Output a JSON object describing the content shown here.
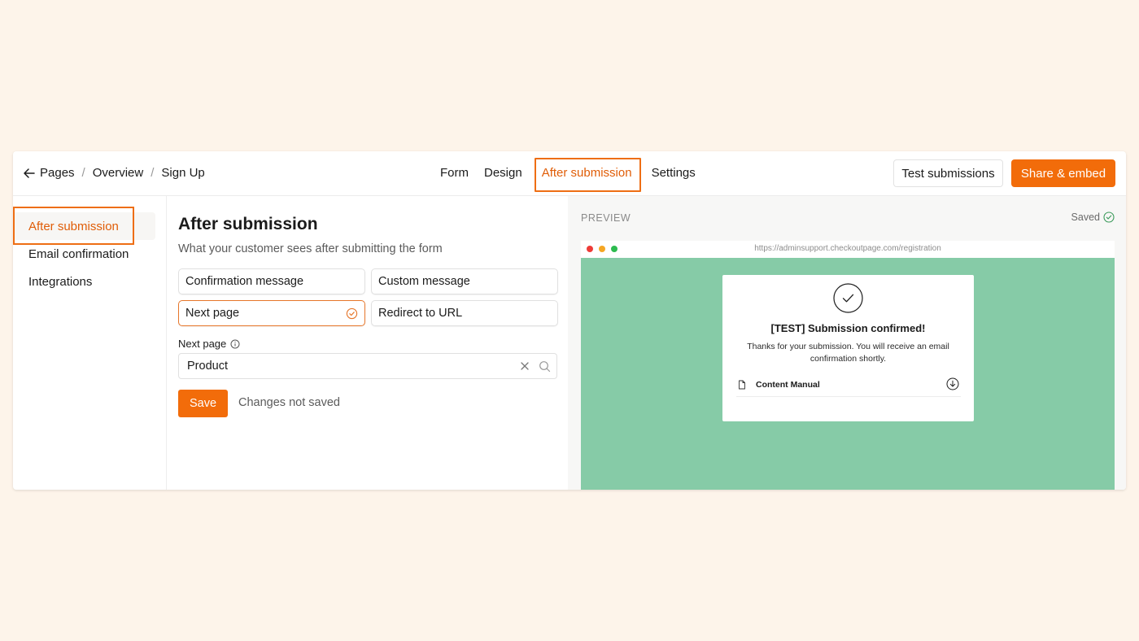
{
  "breadcrumb": [
    "Pages",
    "Overview",
    "Sign Up"
  ],
  "breadcrumb_sep": "/",
  "tabs": {
    "form": "Form",
    "design": "Design",
    "after_submission": "After submission",
    "settings": "Settings",
    "active": "After submission"
  },
  "header_buttons": {
    "test": "Test submissions",
    "share": "Share & embed"
  },
  "sidebar": {
    "items": [
      "After submission",
      "Email confirmation",
      "Integrations"
    ],
    "active": "After submission"
  },
  "main": {
    "title": "After submission",
    "subtitle": "What your customer sees after submitting the form",
    "options": [
      "Confirmation message",
      "Custom message",
      "Next page",
      "Redirect to URL"
    ],
    "selected_option": "Next page",
    "next_page_label": "Next page",
    "next_page_value": "Product",
    "save_label": "Save",
    "status": "Changes not saved"
  },
  "preview": {
    "label": "PREVIEW",
    "saved": "Saved",
    "url": "https://adminsupport.checkoutpage.com/registration",
    "card_title": "[TEST] Submission confirmed!",
    "card_text": "Thanks for your submission. You will receive an email confirmation shortly.",
    "file_name": "Content Manual"
  },
  "colors": {
    "accent": "#f26c0a",
    "highlight_border": "#ee6e14",
    "preview_bg": "#86cba7",
    "page_bg": "#fdf4ea"
  },
  "icons": [
    "back-arrow-icon",
    "info-icon",
    "check-circle-icon",
    "clear-icon",
    "search-icon",
    "document-icon",
    "download-icon",
    "saved-check-icon"
  ]
}
